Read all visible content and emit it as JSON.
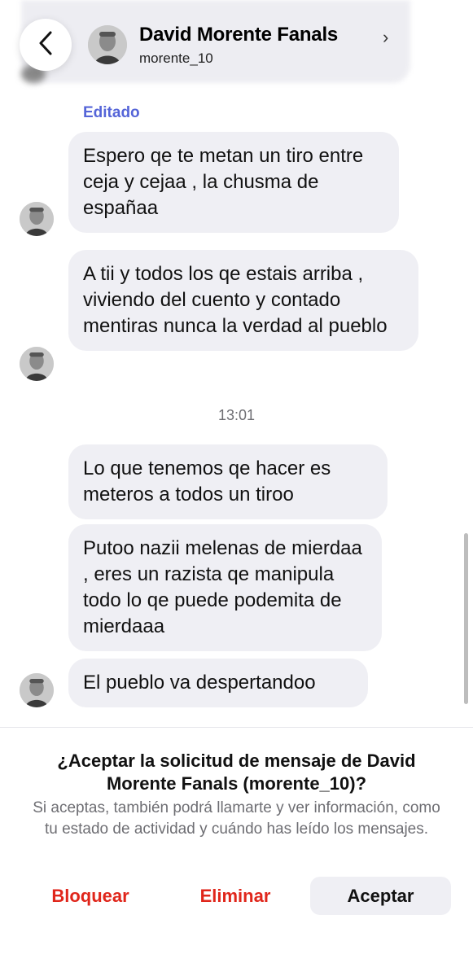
{
  "header": {
    "name": "David Morente Fanals",
    "username": "morente_10"
  },
  "messages": {
    "edited_label": "Editado",
    "group1": [
      "Espero qe te metan un tiro entre ceja y cejaa , la chusma de españaa",
      "A tii y todos los qe estais arriba , viviendo del cuento y contado mentiras nunca la verdad al pueblo"
    ],
    "timestamp": "13:01",
    "group2": [
      "Lo que tenemos qe hacer es meteros a todos un tiroo",
      "Putoo nazii melenas de mierdaa , eres un razista qe manipula todo lo qe puede podemita de mierdaaa",
      "El pueblo va despertandoo"
    ]
  },
  "request": {
    "title": "¿Aceptar la solicitud de mensaje de David Morente Fanals (morente_10)?",
    "body": "Si aceptas, también podrá llamarte y ver información, como tu estado de actividad y cuándo has leído los mensajes.",
    "block_label": "Bloquear",
    "delete_label": "Eliminar",
    "accept_label": "Aceptar"
  },
  "colors": {
    "edited": "#5565d8",
    "destructive": "#e0261b",
    "bubble": "#efeff4"
  }
}
